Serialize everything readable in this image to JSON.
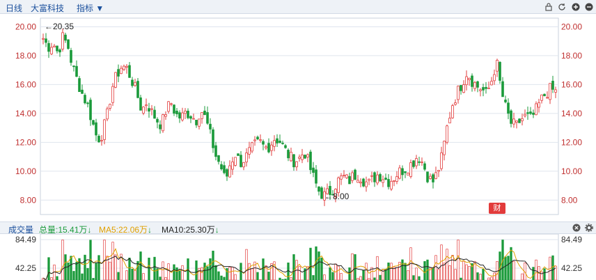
{
  "toolbar": {
    "daily": "日线",
    "stock": "大富科技",
    "indicator": "指标 ▼"
  },
  "icons": [
    "lock-icon",
    "refresh-icon",
    "zoom-in-icon",
    "zoom-out-icon"
  ],
  "price_axis": {
    "ticks": [
      "20.00",
      "18.00",
      "16.00",
      "14.00",
      "12.00",
      "10.00",
      "8.00"
    ],
    "high_label": "←20.35",
    "low_label": "←8.00"
  },
  "badge": "财",
  "volume": {
    "title": "成交量",
    "total": "总量:15.41万",
    "ma5": "MA5:22.06万",
    "ma10": "MA10:25.30万",
    "ticks": [
      "84.49",
      "42.25"
    ]
  },
  "colors": {
    "up": "#e23b3b",
    "down": "#1a9a3a",
    "ma5": "#e0a000",
    "ma10": "#222222"
  },
  "chart_data": {
    "type": "candlestick",
    "ylim": [
      7.0,
      20.6
    ],
    "high": 20.35,
    "low": 8.0,
    "close_series": [
      19.2,
      18.6,
      18.9,
      18.2,
      19.3,
      18.7,
      17.2,
      16.2,
      15.3,
      14.6,
      13.4,
      12.2,
      12.6,
      13.9,
      15.8,
      16.7,
      17.3,
      17.1,
      16.3,
      15.4,
      14.2,
      14.8,
      14.1,
      13.6,
      13.2,
      14.3,
      14.7,
      13.9,
      13.7,
      14.1,
      13.9,
      13.5,
      14.3,
      13.6,
      12.4,
      11.1,
      10.4,
      9.3,
      10.6,
      11.2,
      10.6,
      10.9,
      11.4,
      11.8,
      12.0,
      11.6,
      11.8,
      12.3,
      12.1,
      11.5,
      11.0,
      10.7,
      10.9,
      11.4,
      10.4,
      9.4,
      8.6,
      8.3,
      8.5,
      8.9,
      9.4,
      9.6,
      9.3,
      9.7,
      9.8,
      9.4,
      9.1,
      9.5,
      9.8,
      9.6,
      9.3,
      9.5,
      9.9,
      10.1,
      10.3,
      10.6,
      11.1,
      10.6,
      9.7,
      9.2,
      9.9,
      11.1,
      13.1,
      14.6,
      15.4,
      16.1,
      16.9,
      16.3,
      15.9,
      15.7,
      15.3,
      16.3,
      17.6,
      15.5,
      14.2,
      13.3,
      13.1,
      13.6,
      13.8,
      13.6,
      14.2,
      14.9,
      15.4,
      15.7,
      15.5
    ]
  }
}
